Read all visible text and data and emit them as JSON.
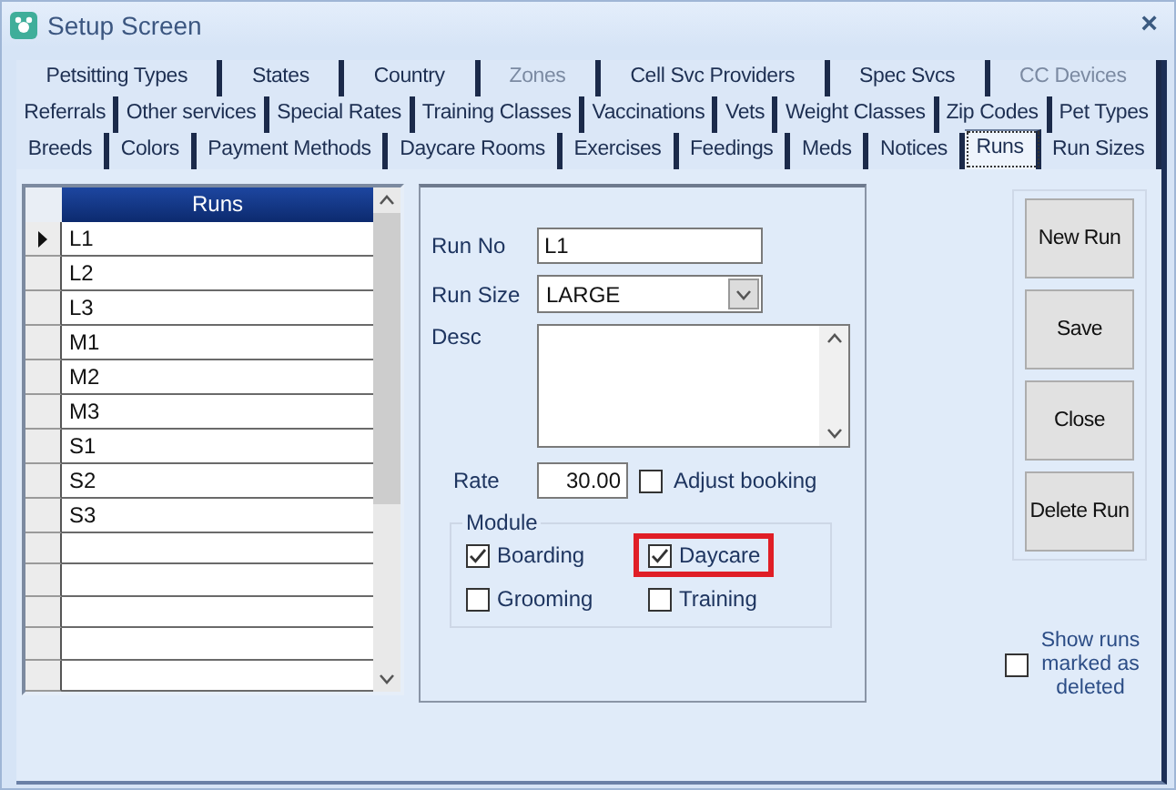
{
  "window": {
    "title": "Setup Screen",
    "close": "×"
  },
  "tab_rows": [
    [
      {
        "label": "Petsitting Types",
        "selected": false,
        "disabled": false
      },
      {
        "label": "States",
        "selected": false,
        "disabled": false
      },
      {
        "label": "Country",
        "selected": false,
        "disabled": false
      },
      {
        "label": "Zones",
        "selected": false,
        "disabled": true
      },
      {
        "label": "Cell Svc Providers",
        "selected": false,
        "disabled": false
      },
      {
        "label": "Spec Svcs",
        "selected": false,
        "disabled": false
      },
      {
        "label": "CC Devices",
        "selected": false,
        "disabled": true
      }
    ],
    [
      {
        "label": "Referrals",
        "selected": false,
        "disabled": false
      },
      {
        "label": "Other services",
        "selected": false,
        "disabled": false
      },
      {
        "label": "Special Rates",
        "selected": false,
        "disabled": false
      },
      {
        "label": "Training Classes",
        "selected": false,
        "disabled": false
      },
      {
        "label": "Vaccinations",
        "selected": false,
        "disabled": false
      },
      {
        "label": "Vets",
        "selected": false,
        "disabled": false
      },
      {
        "label": "Weight Classes",
        "selected": false,
        "disabled": false
      },
      {
        "label": "Zip Codes",
        "selected": false,
        "disabled": false
      },
      {
        "label": "Pet Types",
        "selected": false,
        "disabled": false
      }
    ],
    [
      {
        "label": "Breeds",
        "selected": false,
        "disabled": false
      },
      {
        "label": "Colors",
        "selected": false,
        "disabled": false
      },
      {
        "label": "Payment Methods",
        "selected": false,
        "disabled": false
      },
      {
        "label": "Daycare Rooms",
        "selected": false,
        "disabled": false
      },
      {
        "label": "Exercises",
        "selected": false,
        "disabled": false
      },
      {
        "label": "Feedings",
        "selected": false,
        "disabled": false
      },
      {
        "label": "Meds",
        "selected": false,
        "disabled": false
      },
      {
        "label": "Notices",
        "selected": false,
        "disabled": false
      },
      {
        "label": "Runs",
        "selected": true,
        "disabled": false
      },
      {
        "label": "Run Sizes",
        "selected": false,
        "disabled": false
      }
    ]
  ],
  "grid": {
    "column": "Runs",
    "rows": [
      {
        "value": "L1",
        "selected": true
      },
      {
        "value": "L2",
        "selected": false
      },
      {
        "value": "L3",
        "selected": false
      },
      {
        "value": "M1",
        "selected": false
      },
      {
        "value": "M2",
        "selected": false
      },
      {
        "value": "M3",
        "selected": false
      },
      {
        "value": "S1",
        "selected": false
      },
      {
        "value": "S2",
        "selected": false
      },
      {
        "value": "S3",
        "selected": false
      }
    ]
  },
  "form": {
    "run_no": {
      "label": "Run No",
      "value": "L1"
    },
    "run_size": {
      "label": "Run Size",
      "value": "LARGE"
    },
    "desc": {
      "label": "Desc"
    },
    "rate": {
      "label": "Rate",
      "value": "30.00"
    },
    "adjust_booking": {
      "label": "Adjust booking",
      "checked": false
    },
    "module": {
      "title": "Module",
      "options": [
        {
          "label": "Boarding",
          "checked": true,
          "highlighted": false
        },
        {
          "label": "Daycare",
          "checked": true,
          "highlighted": true
        },
        {
          "label": "Grooming",
          "checked": false,
          "highlighted": false
        },
        {
          "label": "Training",
          "checked": false,
          "highlighted": false
        }
      ]
    }
  },
  "buttons": [
    "New Run",
    "Save",
    "Close",
    "Delete Run"
  ],
  "show_deleted": {
    "label": "Show runs marked as deleted",
    "checked": false
  }
}
